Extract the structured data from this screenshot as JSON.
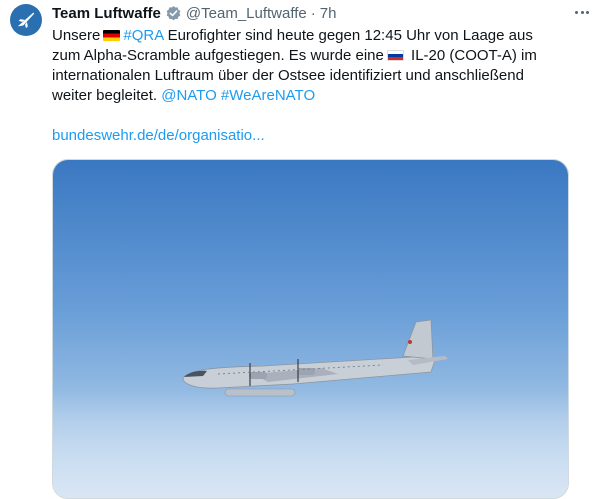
{
  "tweet": {
    "author_name": "Team Luftwaffe",
    "handle": "@Team_Luftwaffe",
    "separator": "·",
    "time": "7h",
    "avatar_icon": "jet-icon",
    "verified_icon": "verified-badge-icon",
    "text": {
      "part1": "Unsere",
      "flag_de": "germany-flag-icon",
      "hashtag_qra": "#QRA",
      "part2": "Eurofighter sind heute gegen 12:45 Uhr von Laage aus zum Alpha-Scramble aufgestiegen. Es wurde eine",
      "flag_ru": "russia-flag-icon",
      "part3": "IL-20  (COOT-A) im internationalen Luftraum über der Ostsee identifiziert und anschließend weiter begleitet.",
      "hashtag_nato": "@NATO",
      "hashtag_wearenato": "#WeAreNATO"
    },
    "link_text": "bundeswehr.de/de/organisatio...",
    "media_alt": "IL-20 aircraft in flight over clouds"
  },
  "colors": {
    "link": "#1d9bf0",
    "secondary": "#536471",
    "sky_top": "#3f7cc4",
    "sky_bottom": "#a8c8ea"
  }
}
